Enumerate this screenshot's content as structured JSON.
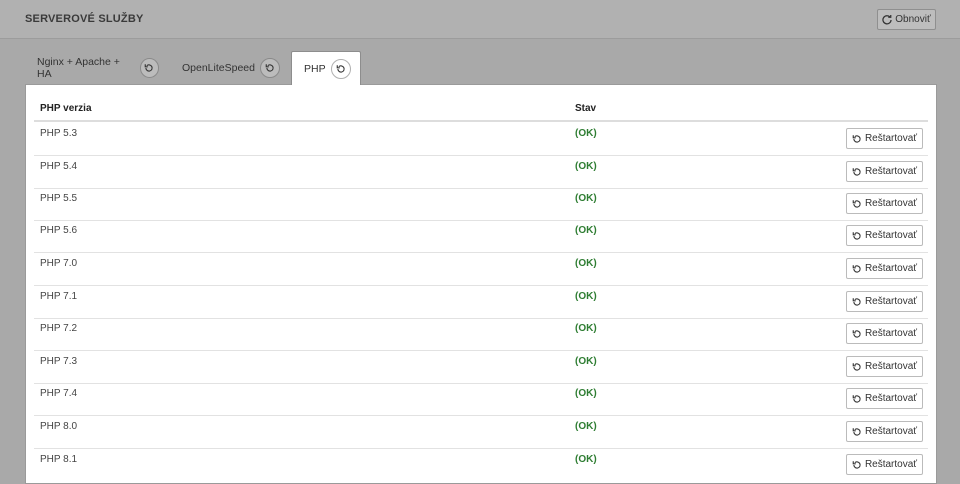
{
  "header": {
    "title": "SERVEROVÉ SLUŽBY",
    "refresh_label": "Obnoviť"
  },
  "tabs": [
    {
      "label": "Nginx + Apache + HA",
      "active": false
    },
    {
      "label": "OpenLiteSpeed",
      "active": false
    },
    {
      "label": "PHP",
      "active": true
    }
  ],
  "table": {
    "columns": [
      "PHP verzia",
      "Stav"
    ],
    "rows": [
      {
        "version": "PHP 5.3",
        "status": "(OK)",
        "action": "Reštartovať"
      },
      {
        "version": "PHP 5.4",
        "status": "(OK)",
        "action": "Reštartovať"
      },
      {
        "version": "PHP 5.5",
        "status": "(OK)",
        "action": "Reštartovať"
      },
      {
        "version": "PHP 5.6",
        "status": "(OK)",
        "action": "Reštartovať"
      },
      {
        "version": "PHP 7.0",
        "status": "(OK)",
        "action": "Reštartovať"
      },
      {
        "version": "PHP 7.1",
        "status": "(OK)",
        "action": "Reštartovať"
      },
      {
        "version": "PHP 7.2",
        "status": "(OK)",
        "action": "Reštartovať"
      },
      {
        "version": "PHP 7.3",
        "status": "(OK)",
        "action": "Reštartovať"
      },
      {
        "version": "PHP 7.4",
        "status": "(OK)",
        "action": "Reštartovať"
      },
      {
        "version": "PHP 8.0",
        "status": "(OK)",
        "action": "Reštartovať"
      },
      {
        "version": "PHP 8.1",
        "status": "(OK)",
        "action": "Reštartovať"
      }
    ]
  },
  "icons": {
    "header_refresh": "refresh-icon",
    "tab_restart": "restart-icon",
    "row_restart": "restart-icon"
  },
  "colors": {
    "status_ok": "#2e7d32",
    "background": "#a9a9a9",
    "panel": "#ffffff"
  }
}
